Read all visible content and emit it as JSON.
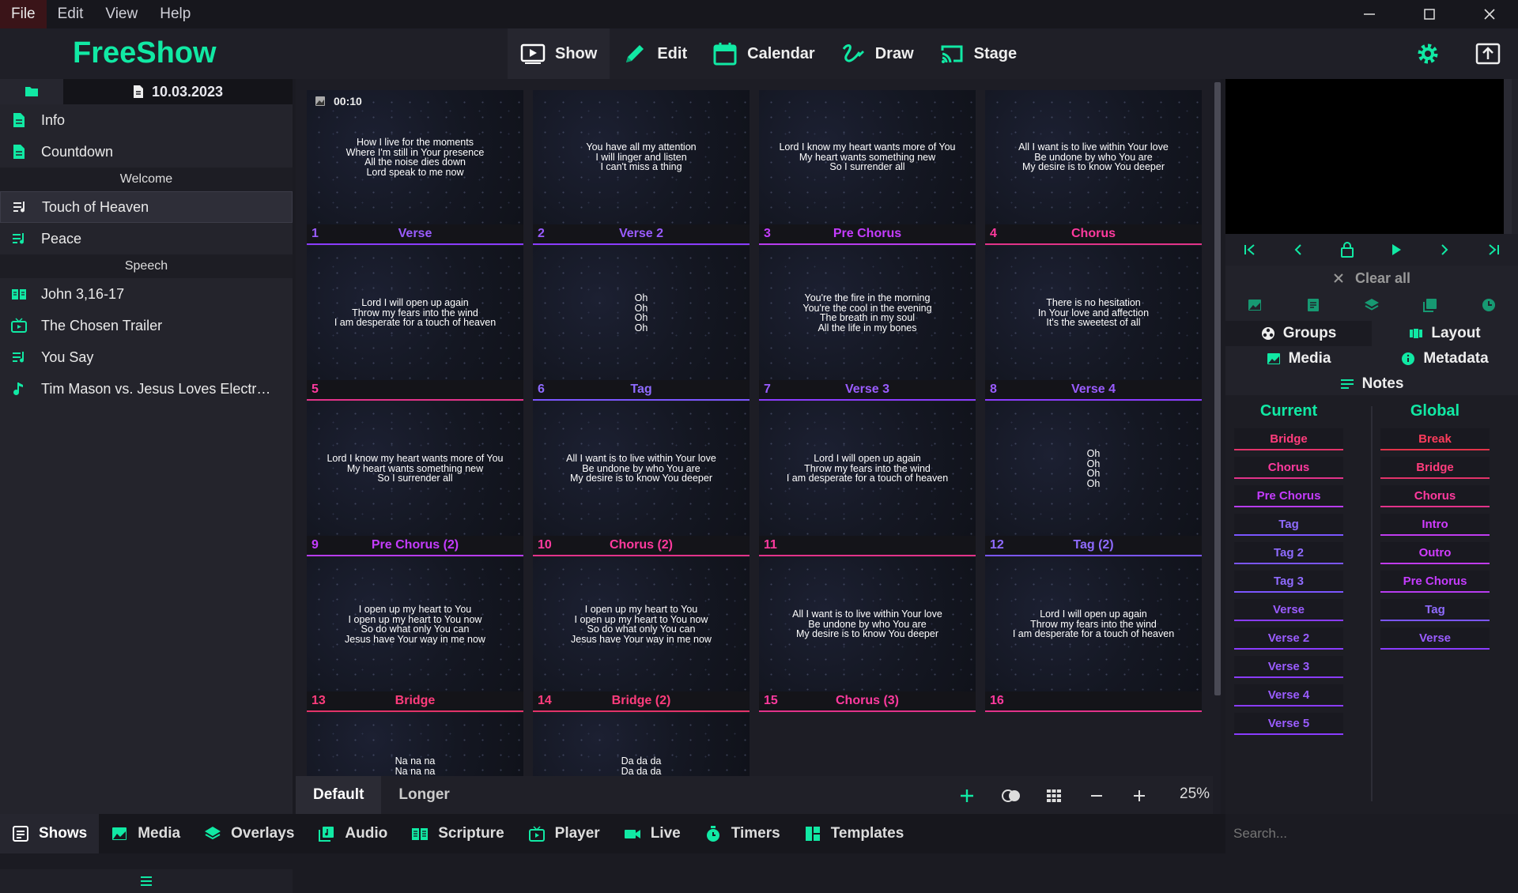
{
  "menu": {
    "file": "File",
    "edit": "Edit",
    "view": "View",
    "help": "Help"
  },
  "app": {
    "title": "FreeShow"
  },
  "modes": {
    "show": "Show",
    "edit": "Edit",
    "calendar": "Calendar",
    "draw": "Draw",
    "stage": "Stage"
  },
  "project": {
    "date": "10.03.2023"
  },
  "sidebar": {
    "info": "Info",
    "countdown": "Countdown",
    "welcome": "Welcome",
    "touch": "Touch of Heaven",
    "peace": "Peace",
    "speech": "Speech",
    "john": "John 3,16-17",
    "trailer": "The Chosen Trailer",
    "yousay": "You Say",
    "timmason": "Tim Mason vs. Jesus Loves Electr…"
  },
  "slides": {
    "timer": "00:10",
    "s1": {
      "num": "1",
      "label": "Verse",
      "text": "How I live for the moments\nWhere I'm still in Your presence\nAll the noise dies down\nLord speak to me now"
    },
    "s2": {
      "num": "2",
      "label": "Verse 2",
      "text": "You have all my attention\nI will linger and listen\nI can't miss a thing"
    },
    "s3": {
      "num": "3",
      "label": "Pre Chorus",
      "text": "Lord I know my heart wants more of You\nMy heart wants something new\nSo I surrender all"
    },
    "s4": {
      "num": "4",
      "label": "Chorus",
      "text": "All I want is to live within Your love\nBe undone by who You are\nMy desire is to know You deeper"
    },
    "s5": {
      "num": "5",
      "label": "",
      "text": "Lord I will open up again\nThrow my fears into the wind\nI am desperate for a touch of heaven"
    },
    "s6": {
      "num": "6",
      "label": "Tag",
      "text": "Oh\nOh\nOh\nOh"
    },
    "s7": {
      "num": "7",
      "label": "Verse 3",
      "text": "You're the fire in the morning\nYou're the cool in the evening\nThe breath in my soul\nAll the life in my bones"
    },
    "s8": {
      "num": "8",
      "label": "Verse 4",
      "text": "There is no hesitation\nIn Your love and affection\nIt's the sweetest of all"
    },
    "s9": {
      "num": "9",
      "label": "Pre Chorus (2)",
      "text": "Lord I know my heart wants more of You\nMy heart wants something new\nSo I surrender all"
    },
    "s10": {
      "num": "10",
      "label": "Chorus (2)",
      "text": "All I want is to live within Your love\nBe undone by who You are\nMy desire is to know You deeper"
    },
    "s11": {
      "num": "11",
      "label": "",
      "text": "Lord I will open up again\nThrow my fears into the wind\nI am desperate for a touch of heaven"
    },
    "s12": {
      "num": "12",
      "label": "Tag (2)",
      "text": "Oh\nOh\nOh\nOh"
    },
    "s13": {
      "num": "13",
      "label": "Bridge",
      "text": "I open up my heart to You\nI open up my heart to You now\nSo do what only You can\nJesus have Your way in me now"
    },
    "s14": {
      "num": "14",
      "label": "Bridge (2)",
      "text": "I open up my heart to You\nI open up my heart to You now\nSo do what only You can\nJesus have Your way in me now"
    },
    "s15": {
      "num": "15",
      "label": "Chorus (3)",
      "text": "All I want is to live within Your love\nBe undone by who You are\nMy desire is to know You deeper"
    },
    "s16": {
      "num": "16",
      "label": "",
      "text": "Lord I will open up again\nThrow my fears into the wind\nI am desperate for a touch of heaven"
    },
    "s17": {
      "num": "",
      "label": "",
      "text": "Na na na\nNa na na"
    },
    "s18": {
      "num": "",
      "label": "",
      "text": "Da da da\nDa da da"
    }
  },
  "layouts": {
    "default": "Default",
    "longer": "Longer",
    "zoom": "25%"
  },
  "right": {
    "clear_all": "Clear all",
    "tabs": {
      "groups": "Groups",
      "layout": "Layout",
      "media": "Media",
      "metadata": "Metadata",
      "notes": "Notes"
    },
    "current_title": "Current",
    "global_title": "Global",
    "current": [
      "Bridge",
      "Chorus",
      "Pre Chorus",
      "Tag",
      "Tag 2",
      "Tag 3",
      "Verse",
      "Verse 2",
      "Verse 3",
      "Verse 4",
      "Verse 5"
    ],
    "global": [
      "Break",
      "Bridge",
      "Chorus",
      "Intro",
      "Outro",
      "Pre Chorus",
      "Tag",
      "Verse"
    ]
  },
  "footer": {
    "shows": "Shows",
    "media": "Media",
    "overlays": "Overlays",
    "audio": "Audio",
    "scripture": "Scripture",
    "player": "Player",
    "live": "Live",
    "timers": "Timers",
    "templates": "Templates"
  },
  "search": {
    "placeholder": "Search..."
  },
  "colors": {
    "accent": "#11e9a4",
    "verse": "#8a3cff",
    "prechorus": "#b73cf0",
    "chorus": "#e2338a",
    "bridge": "#e2336a",
    "tag": "#7b56ff"
  }
}
